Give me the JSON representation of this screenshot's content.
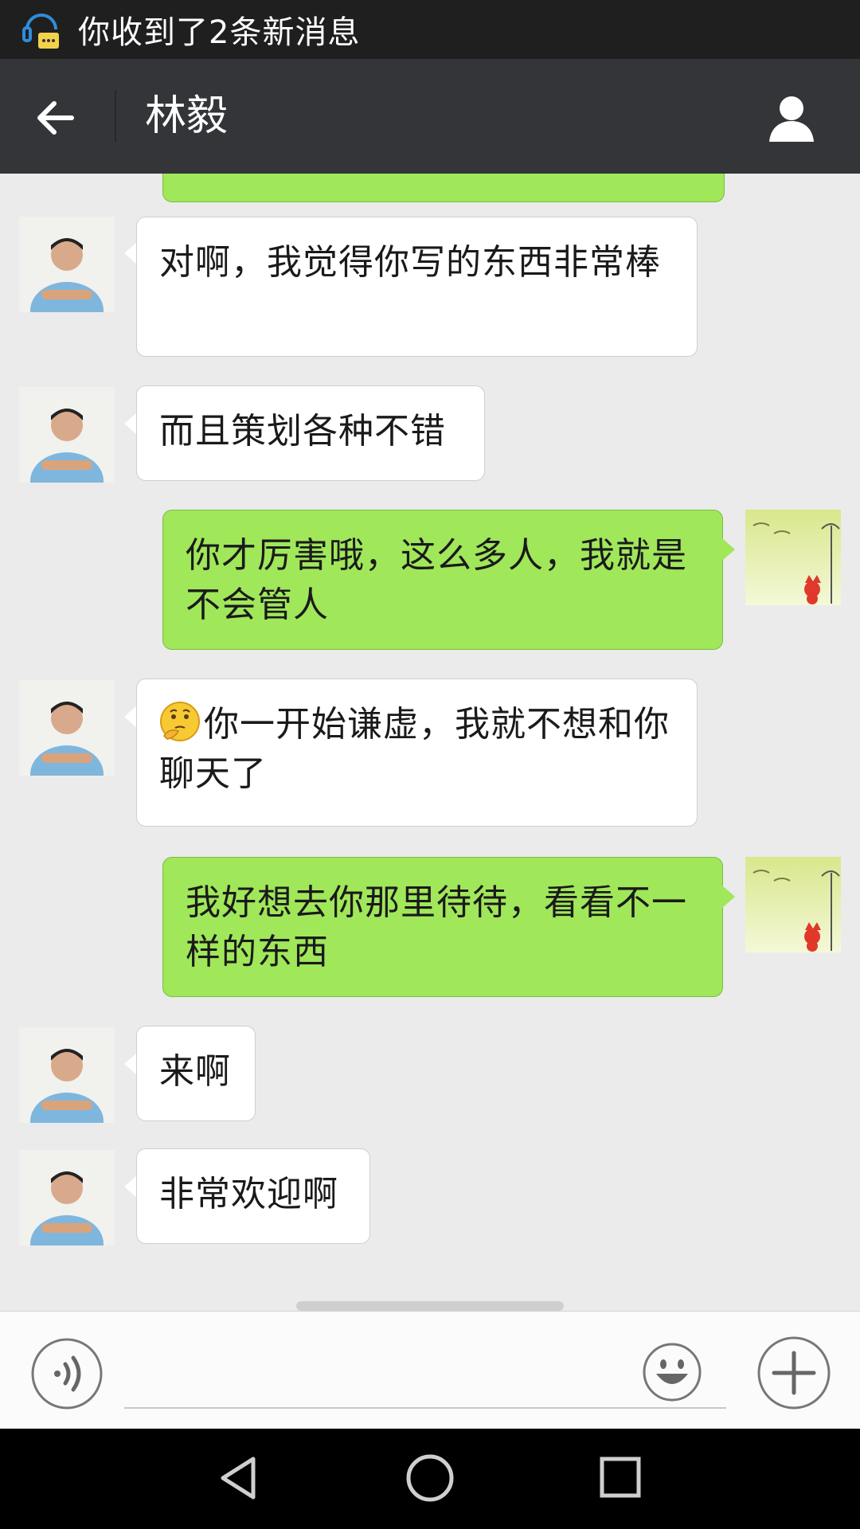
{
  "status_bar": {
    "notification": "你收到了2条新消息",
    "notification_icon": "chat-notification-icon"
  },
  "header": {
    "title": "林毅",
    "back_icon": "arrow-left-icon",
    "profile_icon": "person-icon"
  },
  "messages": [
    {
      "from": "contact",
      "text": "对啊，我觉得你写的东西非常棒"
    },
    {
      "from": "contact",
      "text": "而且策划各种不错"
    },
    {
      "from": "me",
      "text": "你才厉害哦，这么多人，我就是不会管人"
    },
    {
      "from": "contact",
      "emoji": "thinking-face-emoji",
      "text": "你一开始谦虚，我就不想和你聊天了"
    },
    {
      "from": "me",
      "text": "我好想去你那里待待，看看不一样的东西"
    },
    {
      "from": "contact",
      "text": "来啊"
    },
    {
      "from": "contact",
      "text": "非常欢迎啊"
    }
  ],
  "input_bar": {
    "voice_icon": "voice-input-icon",
    "emoji_icon": "smiley-icon",
    "more_icon": "plus-icon"
  },
  "nav_bar": {
    "back_icon": "triangle-back-icon",
    "home_icon": "circle-home-icon",
    "recent_icon": "square-recents-icon"
  },
  "colors": {
    "outgoing_bubble": "#a0e75a",
    "incoming_bubble": "#ffffff",
    "chat_background": "#ebebeb",
    "title_bar": "#333538"
  }
}
